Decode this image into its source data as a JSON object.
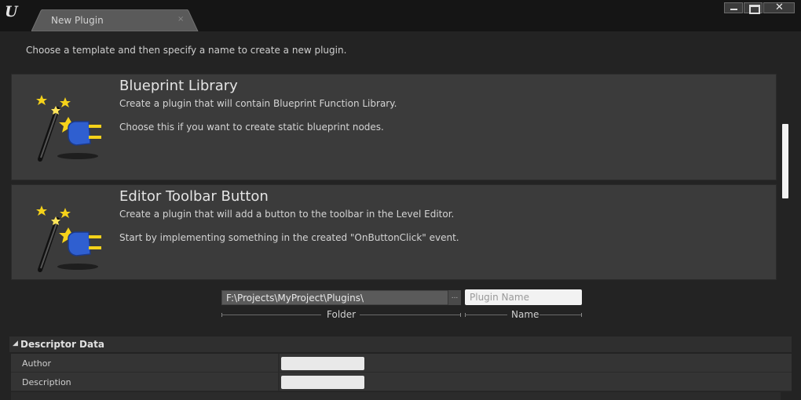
{
  "window": {
    "tab_title": "New Plugin",
    "tab_close": "×",
    "close_label": "✕"
  },
  "instructions": "Choose a template and then specify a name to create a new plugin.",
  "templates": [
    {
      "title": "Blueprint Library",
      "description": "Create a plugin that will contain Blueprint Function Library.",
      "detail": "Choose this if you want to create static blueprint nodes.",
      "icon": "magic-wand-plug-icon"
    },
    {
      "title": "Editor Toolbar Button",
      "description": "Create a plugin that will add a button to the toolbar in the Level Editor.",
      "detail": "Start by implementing something in the created \"OnButtonClick\" event.",
      "icon": "magic-wand-plug-icon"
    }
  ],
  "path": {
    "folder_value": "F:\\Projects\\MyProject\\Plugins\\",
    "browse_label": "...",
    "folder_caption": "Folder",
    "name_placeholder": "Plugin Name",
    "name_caption": "Name"
  },
  "descriptor": {
    "title": "Descriptor Data",
    "fields": [
      {
        "label": "Author",
        "value": ""
      },
      {
        "label": "Description",
        "value": ""
      }
    ]
  },
  "colors": {
    "background": "#232323",
    "card": "#3b3b3b",
    "plug_blue": "#2f5fd0",
    "star_yellow": "#f5d21a"
  }
}
